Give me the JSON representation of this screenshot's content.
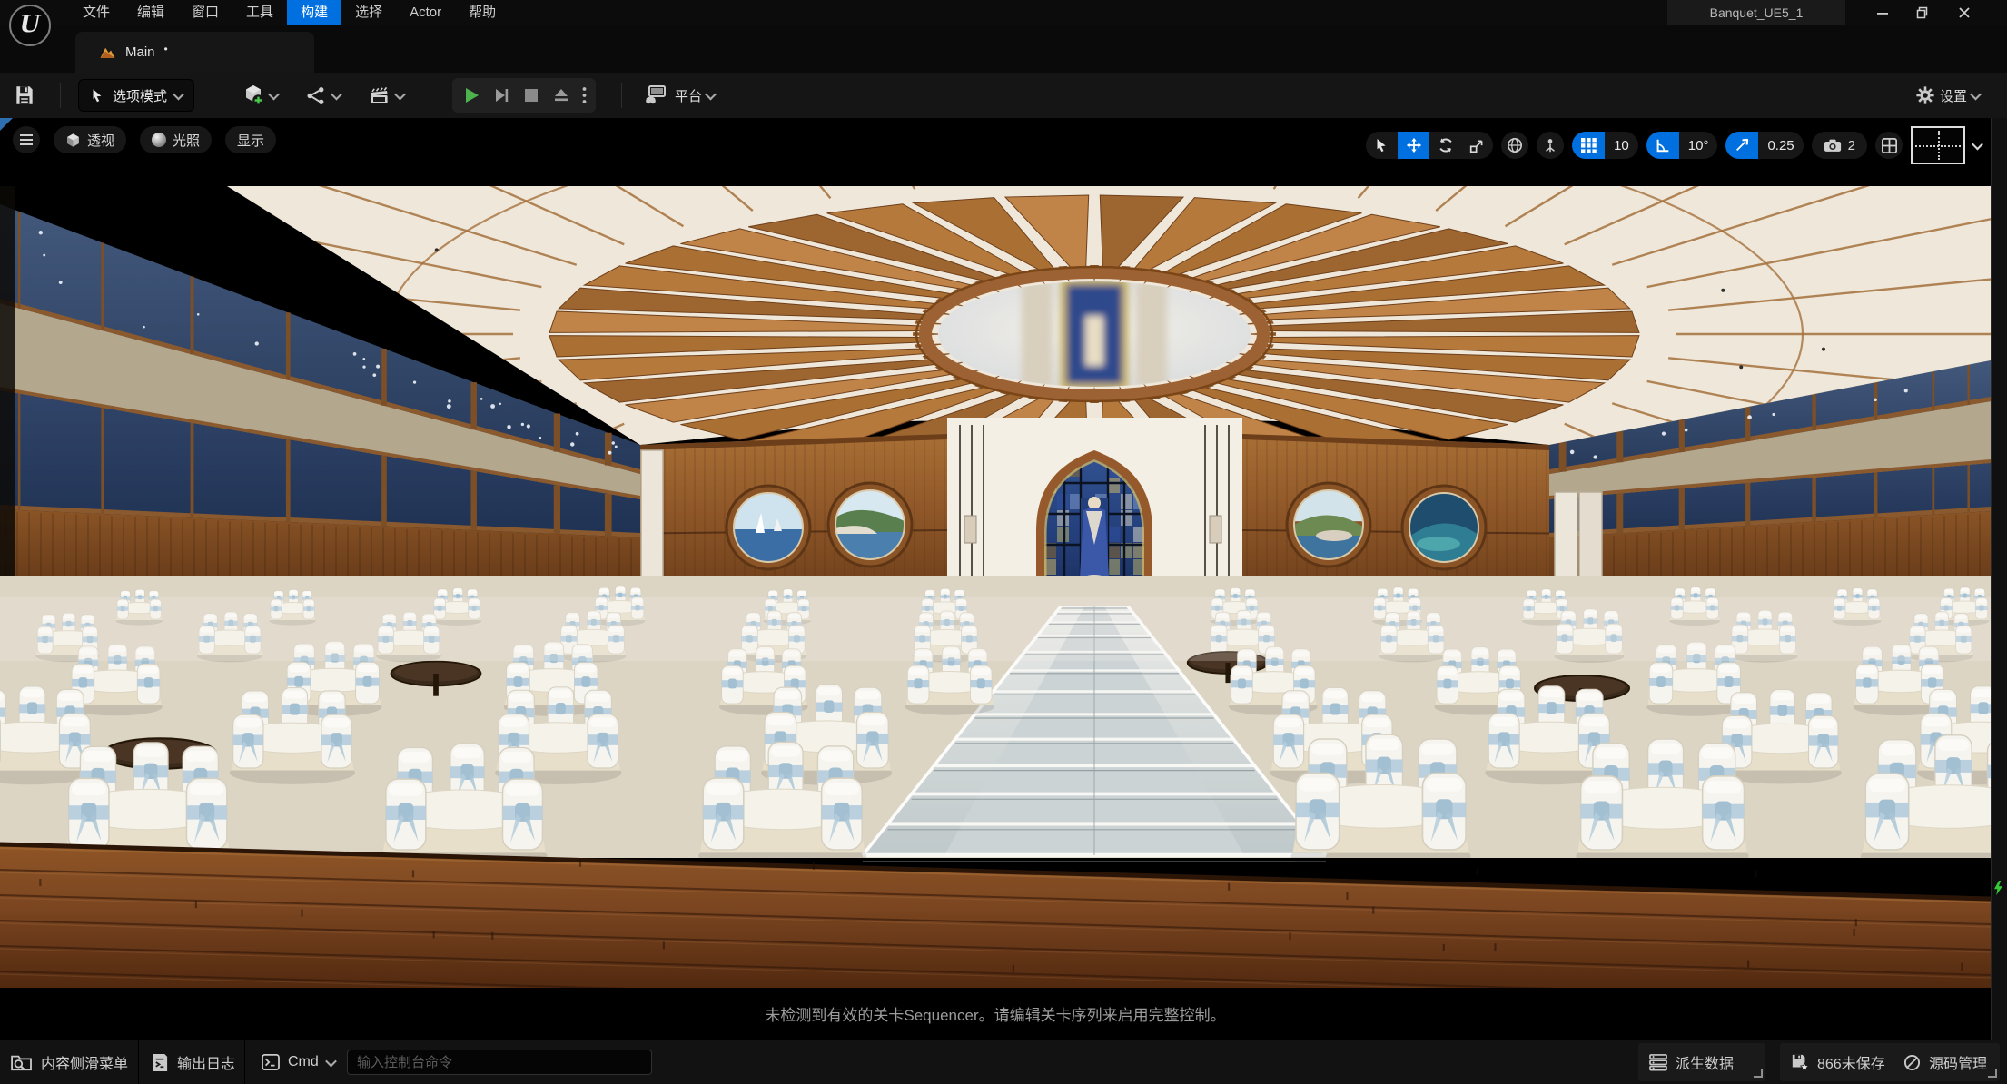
{
  "window": {
    "title": "Banquet_UE5_1"
  },
  "menubar": {
    "items": [
      "文件",
      "编辑",
      "窗口",
      "工具",
      "构建",
      "选择",
      "Actor",
      "帮助"
    ],
    "active": "构建"
  },
  "tab": {
    "label": "Main",
    "dirty": "•"
  },
  "toolbar": {
    "select_mode": "选项模式",
    "platforms": "平台",
    "settings": "设置"
  },
  "viewport_bar": {
    "perspective": "透视",
    "lit": "光照",
    "show": "显示",
    "grid_snap": "10",
    "rotation_snap": "10°",
    "scale_snap": "0.25",
    "camera_speed": "2"
  },
  "viewport_message": "未检测到有效的关卡Sequencer。请编辑关卡序列来启用完整控制。",
  "statusbar": {
    "content_drawer": "内容侧滑菜单",
    "output_log": "输出日志",
    "cmd": "Cmd",
    "console_placeholder": "输入控制台命令",
    "derived_data": "派生数据",
    "unsaved": "866未保存",
    "source_control": "源码管理"
  },
  "colors": {
    "accent": "#0070e0",
    "play_green": "#4db34d"
  }
}
